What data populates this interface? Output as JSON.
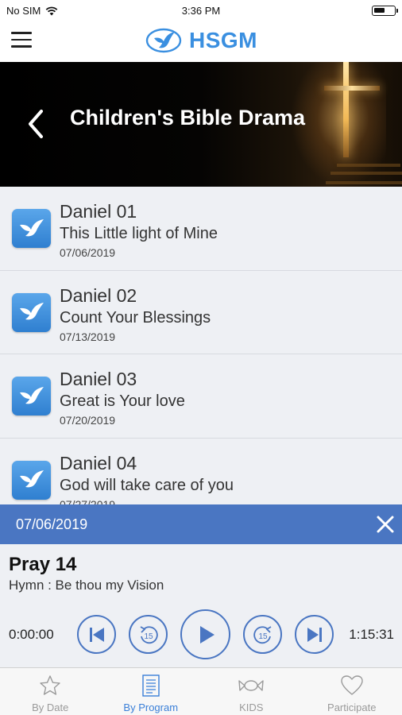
{
  "status_bar": {
    "carrier": "No SIM",
    "time": "3:36 PM",
    "battery_level": 0.55
  },
  "nav": {
    "logo_text": "HSGM",
    "brand_color": "#3a8fe0"
  },
  "hero": {
    "title": "Children's Bible Drama"
  },
  "episodes": [
    {
      "title": "Daniel 01",
      "subtitle": "This Little light of Mine",
      "date": "07/06/2019"
    },
    {
      "title": "Daniel 02",
      "subtitle": "Count Your Blessings",
      "date": "07/13/2019"
    },
    {
      "title": "Daniel 03",
      "subtitle": "Great is Your love",
      "date": "07/20/2019"
    },
    {
      "title": "Daniel 04",
      "subtitle": "God will take care of you",
      "date": "07/27/2019"
    }
  ],
  "player": {
    "date": "07/06/2019",
    "title": "Pray 14",
    "subtitle": "Hymn : Be thou my Vision",
    "current_time": "0:00:00",
    "total_time": "1:15:31",
    "skip_seconds": "15",
    "accent_color": "#4a76c2"
  },
  "tabs": [
    {
      "label": "By Date",
      "icon": "star-icon",
      "active": false
    },
    {
      "label": "By Program",
      "icon": "document-icon",
      "active": true
    },
    {
      "label": "KIDS",
      "icon": "candy-icon",
      "active": false
    },
    {
      "label": "Participate",
      "icon": "heart-icon",
      "active": false
    }
  ]
}
